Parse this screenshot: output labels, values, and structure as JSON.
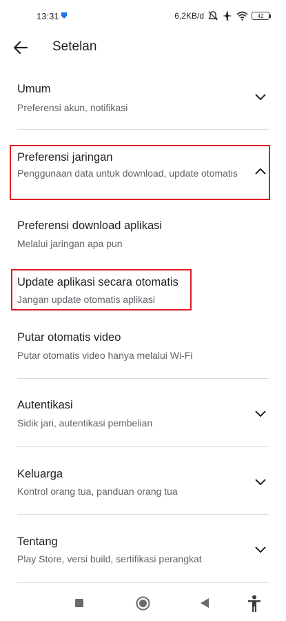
{
  "status_bar": {
    "time": "13:31",
    "network_speed": "6,2KB/d",
    "battery": "42",
    "icons": [
      "shield-icon",
      "mute-icon",
      "airplane-icon",
      "wifi-icon",
      "battery-icon"
    ]
  },
  "app_bar": {
    "title": "Setelan"
  },
  "settings": [
    {
      "title": "Umum",
      "subtitle": "Preferensi akun, notifikasi",
      "expander": "chevron-down"
    },
    {
      "title": "Preferensi jaringan",
      "subtitle": "Penggunaan data untuk download, update otomatis",
      "expander": "chevron-up",
      "highlighted": true
    },
    {
      "title": "Preferensi download aplikasi",
      "subtitle": "Melalui jaringan apa pun"
    },
    {
      "title": "Update aplikasi secara otomatis",
      "subtitle": "Jangan update otomatis aplikasi",
      "highlighted": true
    },
    {
      "title": "Putar otomatis video",
      "subtitle": "Putar otomatis video hanya melalui Wi-Fi"
    },
    {
      "title": "Autentikasi",
      "subtitle": "Sidik jari, autentikasi pembelian",
      "expander": "chevron-down"
    },
    {
      "title": "Keluarga",
      "subtitle": "Kontrol orang tua, panduan orang tua",
      "expander": "chevron-down"
    },
    {
      "title": "Tentang",
      "subtitle": "Play Store, versi build, sertifikasi perangkat",
      "expander": "chevron-down"
    }
  ],
  "nav_bar": {
    "icons": [
      "recents-icon",
      "home-icon",
      "back-icon",
      "accessibility-icon"
    ]
  },
  "colors": {
    "highlight": "#e01b24",
    "divider": "#dadce0",
    "subtitle": "#5f6368"
  }
}
